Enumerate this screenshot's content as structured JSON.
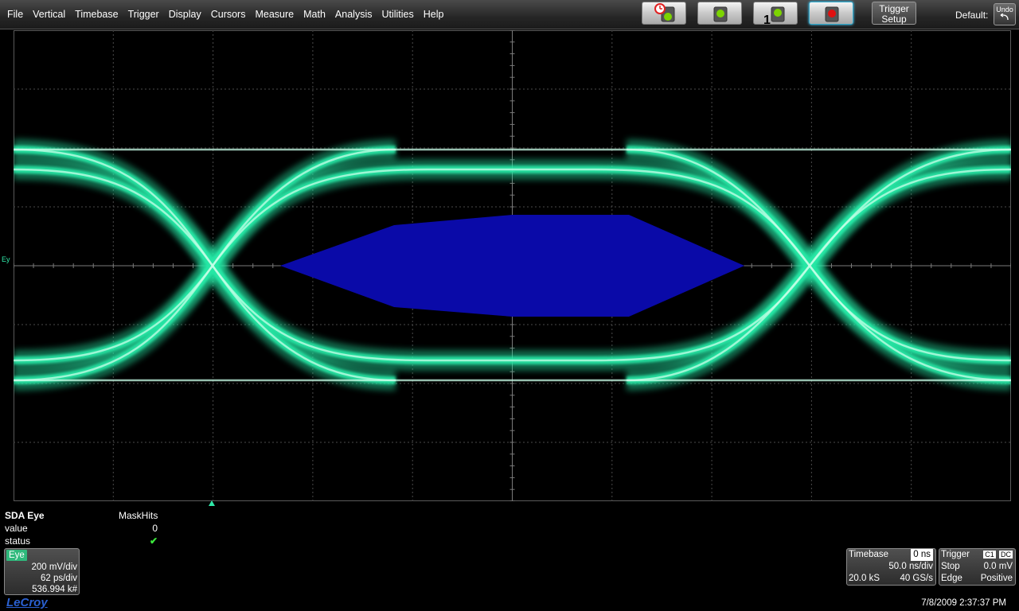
{
  "menu": [
    "File",
    "Vertical",
    "Timebase",
    "Trigger",
    "Display",
    "Cursors",
    "Measure",
    "Math",
    "Analysis",
    "Utilities",
    "Help"
  ],
  "toolbar": {
    "trigger_setup": [
      "Trigger",
      "Setup"
    ],
    "default_label": "Default:",
    "undo_label": "Undo",
    "run_buttons": [
      {
        "name": "auto-trigger-button",
        "icon": "alarm-clock-icon",
        "color": "#7cd400"
      },
      {
        "name": "normal-trigger-button",
        "icon": "traffic-light-icon",
        "color": "#7cd400"
      },
      {
        "name": "single-trigger-button",
        "icon": "single-shot-icon",
        "color": "#7cd400",
        "label": "1"
      },
      {
        "name": "stop-button",
        "icon": "stop-light-icon",
        "color": "#e01010",
        "active": true
      }
    ]
  },
  "display": {
    "channel_marker": "Ey",
    "grid_divisions": {
      "x": 10,
      "y": 8
    },
    "trace_color": "#27e8a6",
    "mask_color": "#0a0aa8"
  },
  "measurement": {
    "title": "SDA Eye",
    "column": "MaskHits",
    "rows": [
      {
        "label": "value",
        "value": "0"
      },
      {
        "label": "status",
        "value": "✔"
      }
    ]
  },
  "eye_channel": {
    "tag": "Eye",
    "vertical": "200 mV/div",
    "horizontal": "62 ps/div",
    "count": "536.994 k#"
  },
  "timebase": {
    "title": "Timebase",
    "delay": "0 ns",
    "scale": "50.0 ns/div",
    "samples": "20.0 kS",
    "rate": "40 GS/s"
  },
  "trigger": {
    "title": "Trigger",
    "channel": "C1",
    "coupling": "DC",
    "mode": "Stop",
    "level": "0.0 mV",
    "type": "Edge",
    "slope": "Positive"
  },
  "datetime": "7/8/2009 2:37:37 PM",
  "brand": "LeCroy"
}
